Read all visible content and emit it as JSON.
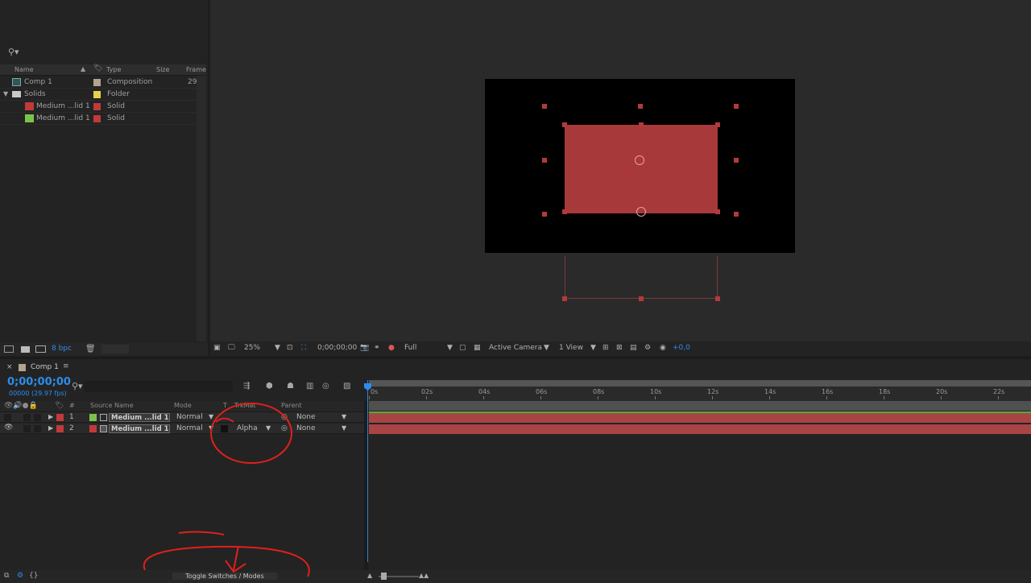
{
  "project": {
    "columns": {
      "name": "Name",
      "type": "Type",
      "size": "Size",
      "frame": "Frame"
    },
    "items": [
      {
        "name": "Comp 1",
        "type": "Composition",
        "frame": "29",
        "color": "#b3a48c"
      },
      {
        "name": "Solids",
        "type": "Folder",
        "color": "#e5d24a"
      },
      {
        "name": "Medium ...lid 1",
        "type": "Solid",
        "color": "#c03a3a"
      },
      {
        "name": "Medium ...lid 1",
        "type": "Solid",
        "color": "#c03a3a",
        "swatch": "#7cc24a"
      }
    ],
    "bpc": "8 bpc"
  },
  "viewer": {
    "zoom": "25%",
    "timecode": "0;00;00;00",
    "resolution": "Full",
    "camera": "Active Camera",
    "views": "1 View",
    "exposure": "+0,0",
    "solid_color": "#a8393b"
  },
  "timeline": {
    "tab": "Comp 1",
    "timecode": "0;00;00;00",
    "frame_info": "00000 (29.97 fps)",
    "columns": {
      "num": "#",
      "source": "Source Name",
      "mode": "Mode",
      "t": "T",
      "trkmat": "TrkMat",
      "parent": "Parent"
    },
    "layers": [
      {
        "num": "1",
        "name": "Medium ...lid 1",
        "mode": "Normal",
        "trkmat": "",
        "parent": "None",
        "color": "#7cc24a"
      },
      {
        "num": "2",
        "name": "Medium ...lid 1",
        "mode": "Normal",
        "trkmat": "Alpha",
        "parent": "None",
        "color": "#c03a3a"
      }
    ],
    "ticks": [
      "0s",
      "02s",
      "04s",
      "06s",
      "08s",
      "10s",
      "12s",
      "14s",
      "16s",
      "18s",
      "20s",
      "22s"
    ],
    "toggle_label": "Toggle Switches / Modes",
    "accent": "#2d8ceb",
    "annotation_color": "#e0201c"
  }
}
